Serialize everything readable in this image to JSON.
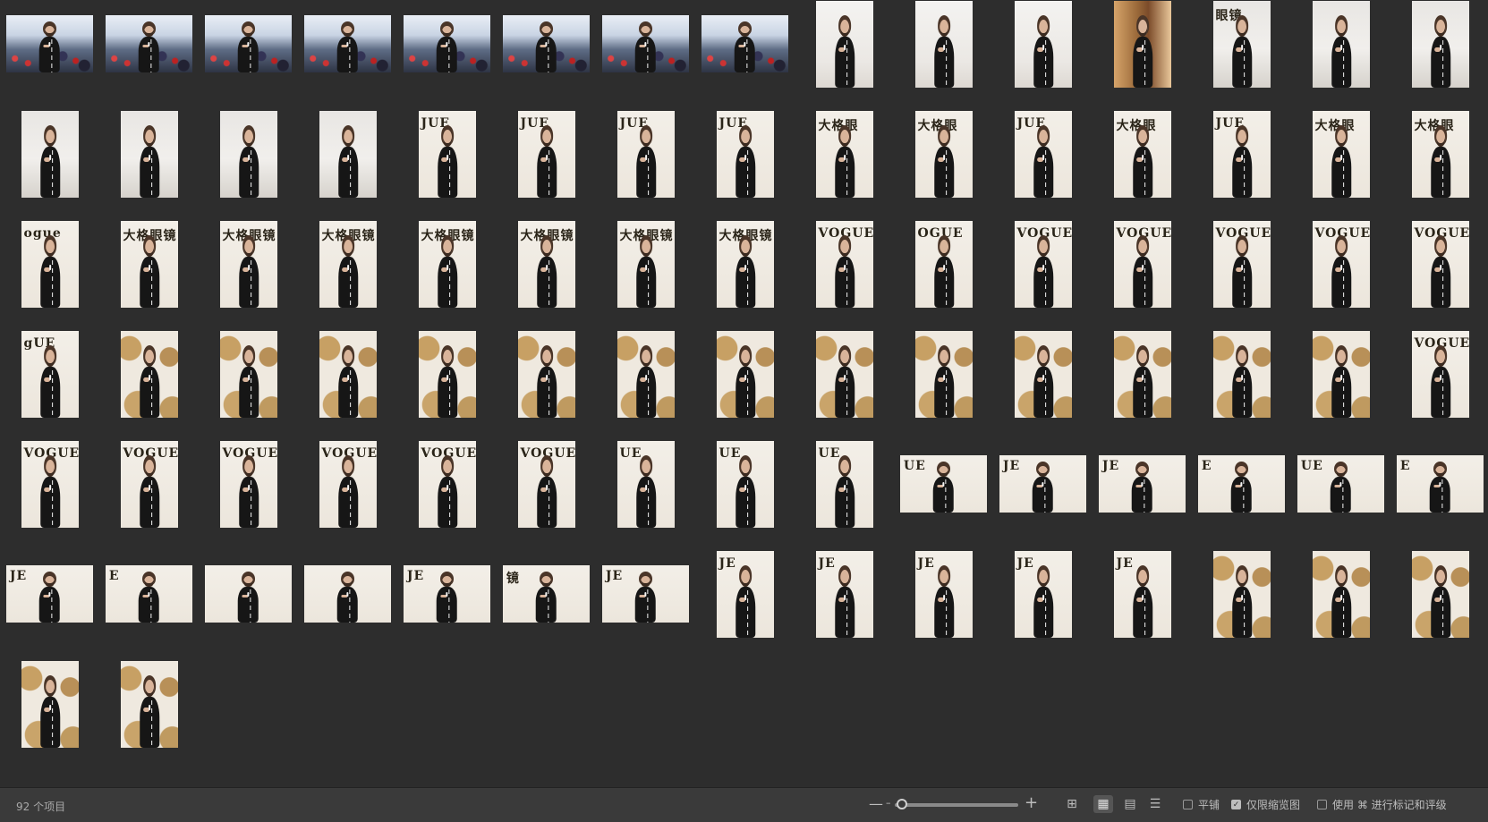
{
  "status": {
    "item_count": "92 个项目",
    "zoom_level": 0.03
  },
  "view_modes": [
    {
      "name": "grid-view-icon",
      "active": false
    },
    {
      "name": "large-grid-view-icon",
      "active": true
    },
    {
      "name": "filmstrip-view-icon",
      "active": false
    },
    {
      "name": "list-view-icon",
      "active": false
    }
  ],
  "options": {
    "tile": {
      "label": "平铺",
      "checked": false
    },
    "thumbs_only": {
      "label": "仅限缩览图",
      "checked": true
    },
    "rating": {
      "label": "使用 ⌘ 进行标记和评级",
      "checked": false
    }
  },
  "thumbnails": [
    {
      "o": "l",
      "s": "crowd"
    },
    {
      "o": "l",
      "s": "crowd"
    },
    {
      "o": "l",
      "s": "crowd"
    },
    {
      "o": "l",
      "s": "crowd"
    },
    {
      "o": "l",
      "s": "crowd"
    },
    {
      "o": "l",
      "s": "crowd"
    },
    {
      "o": "l",
      "s": "crowd"
    },
    {
      "o": "l",
      "s": "crowd"
    },
    {
      "o": "p",
      "s": "white"
    },
    {
      "o": "p",
      "s": "white"
    },
    {
      "o": "p",
      "s": "white"
    },
    {
      "o": "p",
      "s": "window"
    },
    {
      "o": "p",
      "s": "sofa",
      "logo": "眼镜"
    },
    {
      "o": "p",
      "s": "sofa"
    },
    {
      "o": "p",
      "s": "sofa"
    },
    {
      "o": "p",
      "s": "sofa"
    },
    {
      "o": "p",
      "s": "sofa"
    },
    {
      "o": "p",
      "s": "sofa"
    },
    {
      "o": "p",
      "s": "sofa"
    },
    {
      "o": "p",
      "s": "vogue",
      "logo": "JUE"
    },
    {
      "o": "p",
      "s": "vogue",
      "logo": "JUE"
    },
    {
      "o": "p",
      "s": "vogue",
      "logo": "JUE"
    },
    {
      "o": "p",
      "s": "vogue",
      "logo": "JUE"
    },
    {
      "o": "p",
      "s": "vogue",
      "logo": "大格眼"
    },
    {
      "o": "p",
      "s": "vogue",
      "logo": "大格眼"
    },
    {
      "o": "p",
      "s": "vogue",
      "logo": "JUE"
    },
    {
      "o": "p",
      "s": "vogue",
      "logo": "大格眼"
    },
    {
      "o": "p",
      "s": "vogue",
      "logo": "JUE"
    },
    {
      "o": "p",
      "s": "vogue",
      "logo": "大格眼"
    },
    {
      "o": "p",
      "s": "vogue",
      "logo": "大格眼"
    },
    {
      "o": "p",
      "s": "vogue",
      "logo": "ogue"
    },
    {
      "o": "p",
      "s": "vogue",
      "logo": "大格眼镜"
    },
    {
      "o": "p",
      "s": "vogue",
      "logo": "大格眼镜"
    },
    {
      "o": "p",
      "s": "vogue",
      "logo": "大格眼镜"
    },
    {
      "o": "p",
      "s": "vogue",
      "logo": "大格眼镜"
    },
    {
      "o": "p",
      "s": "vogue",
      "logo": "大格眼镜"
    },
    {
      "o": "p",
      "s": "vogue",
      "logo": "大格眼镜"
    },
    {
      "o": "p",
      "s": "vogue",
      "logo": "大格眼镜"
    },
    {
      "o": "p",
      "s": "vogue",
      "logo": "VOGUE"
    },
    {
      "o": "p",
      "s": "vogue",
      "logo": "OGUE"
    },
    {
      "o": "p",
      "s": "vogue",
      "logo": "VOGUE"
    },
    {
      "o": "p",
      "s": "vogue",
      "logo": "VOGUE"
    },
    {
      "o": "p",
      "s": "vogue",
      "logo": "VOGUE"
    },
    {
      "o": "p",
      "s": "vogue",
      "logo": "VOGUE"
    },
    {
      "o": "p",
      "s": "vogue",
      "logo": "VOGUE"
    },
    {
      "o": "p",
      "s": "vogue",
      "logo": "gUE"
    },
    {
      "o": "p",
      "s": "gold"
    },
    {
      "o": "p",
      "s": "gold"
    },
    {
      "o": "p",
      "s": "gold"
    },
    {
      "o": "p",
      "s": "gold"
    },
    {
      "o": "p",
      "s": "gold"
    },
    {
      "o": "p",
      "s": "gold"
    },
    {
      "o": "p",
      "s": "gold"
    },
    {
      "o": "p",
      "s": "gold"
    },
    {
      "o": "p",
      "s": "gold"
    },
    {
      "o": "p",
      "s": "gold"
    },
    {
      "o": "p",
      "s": "gold"
    },
    {
      "o": "p",
      "s": "gold"
    },
    {
      "o": "p",
      "s": "gold"
    },
    {
      "o": "p",
      "s": "vogue",
      "logo": "VOGUE"
    },
    {
      "o": "p",
      "s": "vogue",
      "logo": "VOGUE"
    },
    {
      "o": "p",
      "s": "vogue",
      "logo": "VOGUE"
    },
    {
      "o": "p",
      "s": "vogue",
      "logo": "VOGUE"
    },
    {
      "o": "p",
      "s": "vogue",
      "logo": "VOGUE"
    },
    {
      "o": "p",
      "s": "vogue",
      "logo": "VOGUE"
    },
    {
      "o": "p",
      "s": "vogue",
      "logo": "VOGUE"
    },
    {
      "o": "p",
      "s": "vogue",
      "logo": "UE"
    },
    {
      "o": "p",
      "s": "vogue",
      "logo": "UE"
    },
    {
      "o": "p",
      "s": "vogue",
      "logo": "UE"
    },
    {
      "o": "l",
      "s": "vogue",
      "logo": "UE"
    },
    {
      "o": "l",
      "s": "vogue",
      "logo": "JE"
    },
    {
      "o": "l",
      "s": "vogue",
      "logo": "JE"
    },
    {
      "o": "l",
      "s": "vogue",
      "logo": "E"
    },
    {
      "o": "l",
      "s": "vogue",
      "logo": "UE"
    },
    {
      "o": "l",
      "s": "vogue",
      "logo": "E"
    },
    {
      "o": "l",
      "s": "vogue",
      "logo": "JE"
    },
    {
      "o": "l",
      "s": "vogue",
      "logo": "E"
    },
    {
      "o": "l",
      "s": "vogue"
    },
    {
      "o": "l",
      "s": "vogue"
    },
    {
      "o": "l",
      "s": "vogue",
      "logo": "JE"
    },
    {
      "o": "l",
      "s": "vogue",
      "logo": "镜"
    },
    {
      "o": "l",
      "s": "vogue",
      "logo": "JE"
    },
    {
      "o": "p",
      "s": "vogue",
      "logo": "JE"
    },
    {
      "o": "p",
      "s": "vogue",
      "logo": "JE"
    },
    {
      "o": "p",
      "s": "vogue",
      "logo": "JE"
    },
    {
      "o": "p",
      "s": "vogue",
      "logo": "JE"
    },
    {
      "o": "p",
      "s": "vogue",
      "logo": "JE"
    },
    {
      "o": "p",
      "s": "gold"
    },
    {
      "o": "p",
      "s": "gold"
    },
    {
      "o": "p",
      "s": "gold"
    },
    {
      "o": "p",
      "s": "gold"
    },
    {
      "o": "p",
      "s": "gold"
    }
  ]
}
